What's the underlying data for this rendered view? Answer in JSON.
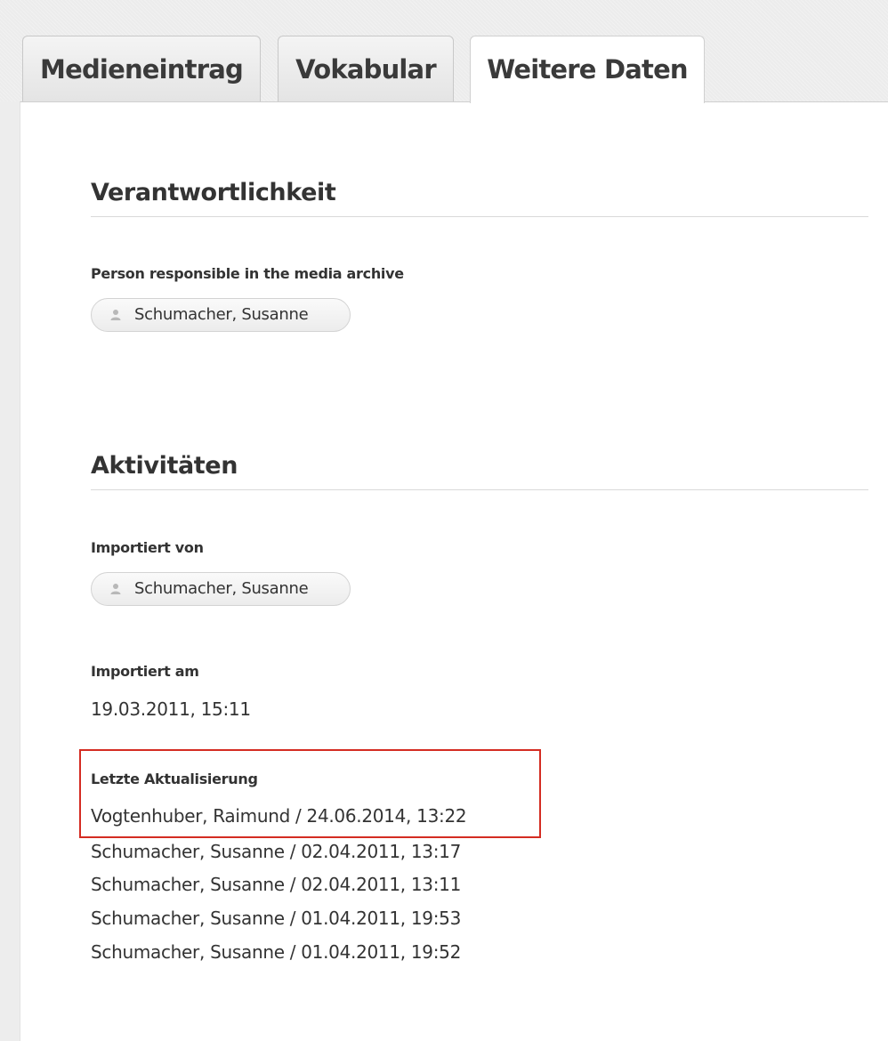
{
  "tabs": [
    {
      "label": "Medieneintrag",
      "active": false
    },
    {
      "label": "Vokabular",
      "active": false
    },
    {
      "label": "Weitere Daten",
      "active": true
    }
  ],
  "responsibility": {
    "title": "Verantwortlichkeit",
    "person_label": "Person responsible in the media archive",
    "person_name": "Schumacher, Susanne",
    "person_icon": "user-icon"
  },
  "activities": {
    "title": "Aktivitäten",
    "imported_by_label": "Importiert von",
    "imported_by_name": "Schumacher, Susanne",
    "imported_at_label": "Importiert am",
    "imported_at_value": "19.03.2011, 15:11",
    "last_update_label": "Letzte Aktualisierung",
    "updates": [
      "Vogtenhuber, Raimund / 24.06.2014, 13:22",
      "Schumacher, Susanne / 02.04.2011, 13:17",
      "Schumacher, Susanne / 02.04.2011, 13:11",
      "Schumacher, Susanne / 01.04.2011, 19:53",
      "Schumacher, Susanne / 01.04.2011, 19:52"
    ]
  },
  "colors": {
    "highlight_border": "#d42c22",
    "page_background": "#ededed",
    "panel_background": "#ffffff",
    "text": "#333333"
  }
}
